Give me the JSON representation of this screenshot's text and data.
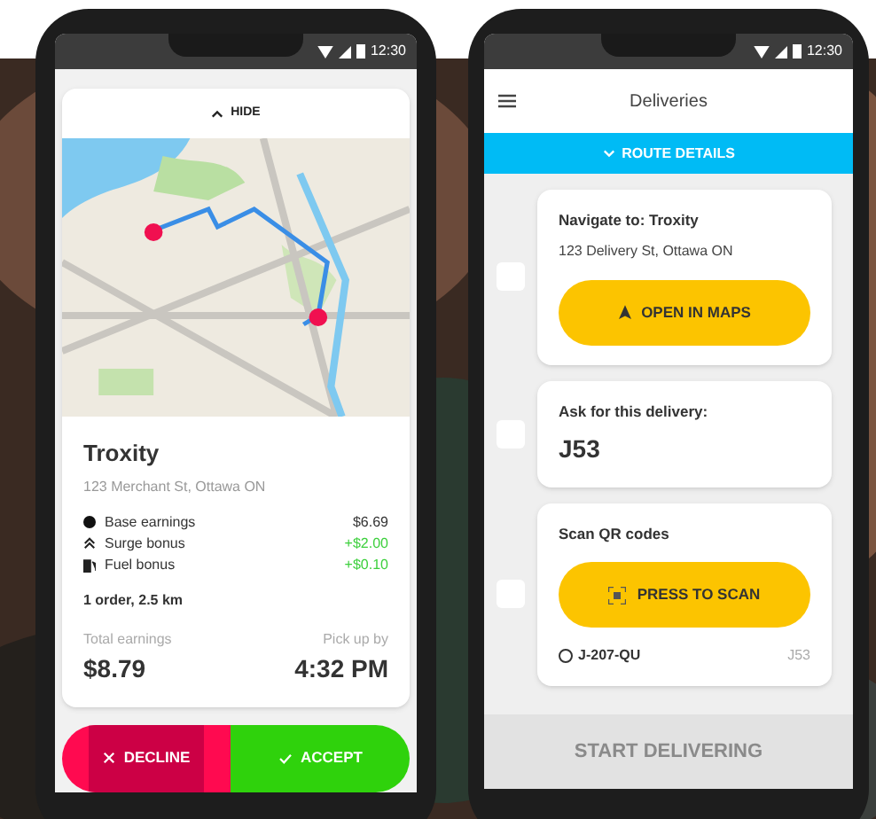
{
  "offer_screen": {
    "status_time": "12:30",
    "hide_label": "HIDE",
    "merchant": "Troxity",
    "address": "123 Merchant St, Ottawa ON",
    "earnings": [
      {
        "kind": "base",
        "label": "Base earnings",
        "amount": "$6.69",
        "bonus": false
      },
      {
        "kind": "surge",
        "label": "Surge bonus",
        "amount": "+$2.00",
        "bonus": true
      },
      {
        "kind": "fuel",
        "label": "Fuel bonus",
        "amount": "+$0.10",
        "bonus": true
      }
    ],
    "summary": "1 order, 2.5 km",
    "total_label": "Total earnings",
    "total_value": "$8.79",
    "pickup_label": "Pick up by",
    "pickup_value": "4:32 PM",
    "decline_label": "DECLINE",
    "accept_label": "ACCEPT"
  },
  "deliveries_screen": {
    "status_time": "12:30",
    "title": "Deliveries",
    "route_label": "ROUTE DETAILS",
    "route_expanded": false,
    "steps": [
      {
        "kind": "navigate",
        "checked": false,
        "title": "Navigate to: Troxity",
        "subtitle": "123 Delivery St, Ottawa ON",
        "button": "OPEN IN MAPS"
      },
      {
        "kind": "code",
        "checked": false,
        "title": "Ask for this delivery:",
        "code": "J53"
      },
      {
        "kind": "scan",
        "checked": false,
        "title": "Scan QR codes",
        "button": "PRESS TO SCAN",
        "items": [
          {
            "code": "J-207-QU",
            "scanned": false,
            "tag": "J53"
          }
        ]
      }
    ],
    "start_label": "START DELIVERING",
    "start_disabled": true
  }
}
